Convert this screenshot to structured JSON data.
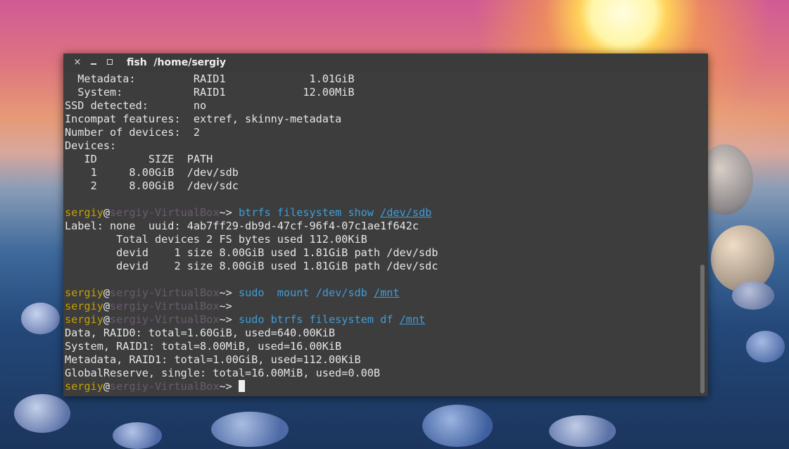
{
  "window": {
    "title": "fish  /home/sergiy",
    "close_glyph": "×"
  },
  "terminal": {
    "prompt": {
      "user": "sergiy",
      "at": "@",
      "host": "sergiy-VirtualBox",
      "arrow": "~>"
    },
    "lines": {
      "l1": "  Metadata:         RAID1             1.01GiB",
      "l2": "  System:           RAID1            12.00MiB",
      "l3": "SSD detected:       no",
      "l4": "Incompat features:  extref, skinny-metadata",
      "l5": "Number of devices:  2",
      "l6": "Devices:",
      "l7": "   ID        SIZE  PATH",
      "l8": "    1     8.00GiB  /dev/sdb",
      "l9": "    2     8.00GiB  /dev/sdc",
      "l12": "Label: none  uuid: 4ab7ff29-db9d-47cf-96f4-07c1ae1f642c",
      "l13": "        Total devices 2 FS bytes used 112.00KiB",
      "l14": "        devid    1 size 8.00GiB used 1.81GiB path /dev/sdb",
      "l15": "        devid    2 size 8.00GiB used 1.81GiB path /dev/sdc",
      "l20": "Data, RAID0: total=1.60GiB, used=640.00KiB",
      "l21": "System, RAID1: total=8.00MiB, used=16.00KiB",
      "l22": "Metadata, RAID1: total=1.00GiB, used=112.00KiB",
      "l23": "GlobalReserve, single: total=16.00MiB, used=0.00B"
    },
    "commands": {
      "c1": {
        "cmd": "btrfs filesystem show ",
        "arg": "/dev/sdb"
      },
      "c2": {
        "cmd": "sudo  mount /dev/sdb ",
        "arg": "/mnt"
      },
      "c3": {
        "cmd": "sudo btrfs filesystem df ",
        "arg": "/mnt"
      }
    }
  }
}
